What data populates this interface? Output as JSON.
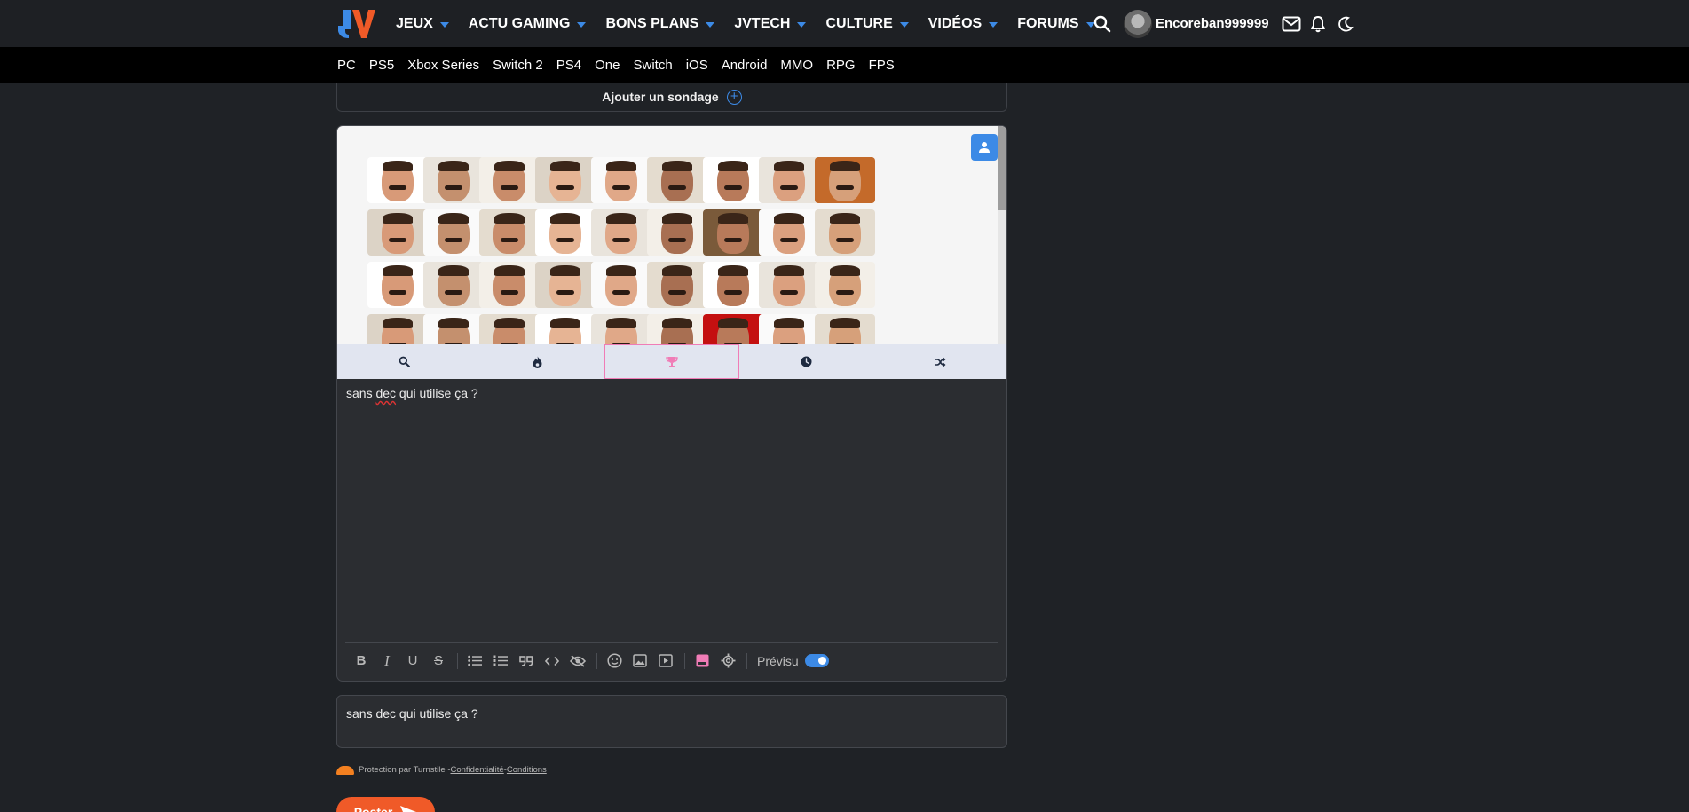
{
  "header": {
    "logo_text": "JV",
    "nav": [
      {
        "label": "JEUX"
      },
      {
        "label": "ACTU GAMING"
      },
      {
        "label": "BONS PLANS"
      },
      {
        "label": "JVTECH"
      },
      {
        "label": "CULTURE"
      },
      {
        "label": "VIDÉOS"
      },
      {
        "label": "FORUMS"
      }
    ],
    "username": "Encoreban999999",
    "icons": [
      "search-icon",
      "mail-icon",
      "bell-icon",
      "moon-icon"
    ]
  },
  "platforms": [
    "PC",
    "PS5",
    "Xbox Series",
    "Switch 2",
    "PS4",
    "One",
    "Switch",
    "iOS",
    "Android",
    "MMO",
    "RPG",
    "FPS"
  ],
  "poll": {
    "label": "Ajouter un sondage"
  },
  "sticker_tabs": [
    "search-icon",
    "flame-icon",
    "trophy-icon",
    "clock-icon",
    "shuffle-icon"
  ],
  "editor": {
    "text_before": "sans ",
    "text_misspelled": "dec",
    "text_after": " qui utilise ça ?",
    "preview_label": "Prévisu"
  },
  "preview": {
    "text": "sans dec qui utilise ça ?"
  },
  "turnstile": {
    "prefix": "Protection par Turnstile - ",
    "privacy": "Confidentialité",
    "sep": " - ",
    "terms": "Conditions"
  },
  "submit": {
    "label": "Poster"
  },
  "colors": {
    "accent": "#3c8ae6",
    "brand_orange": "#f05a28",
    "tab_active": "#f07cb6"
  }
}
